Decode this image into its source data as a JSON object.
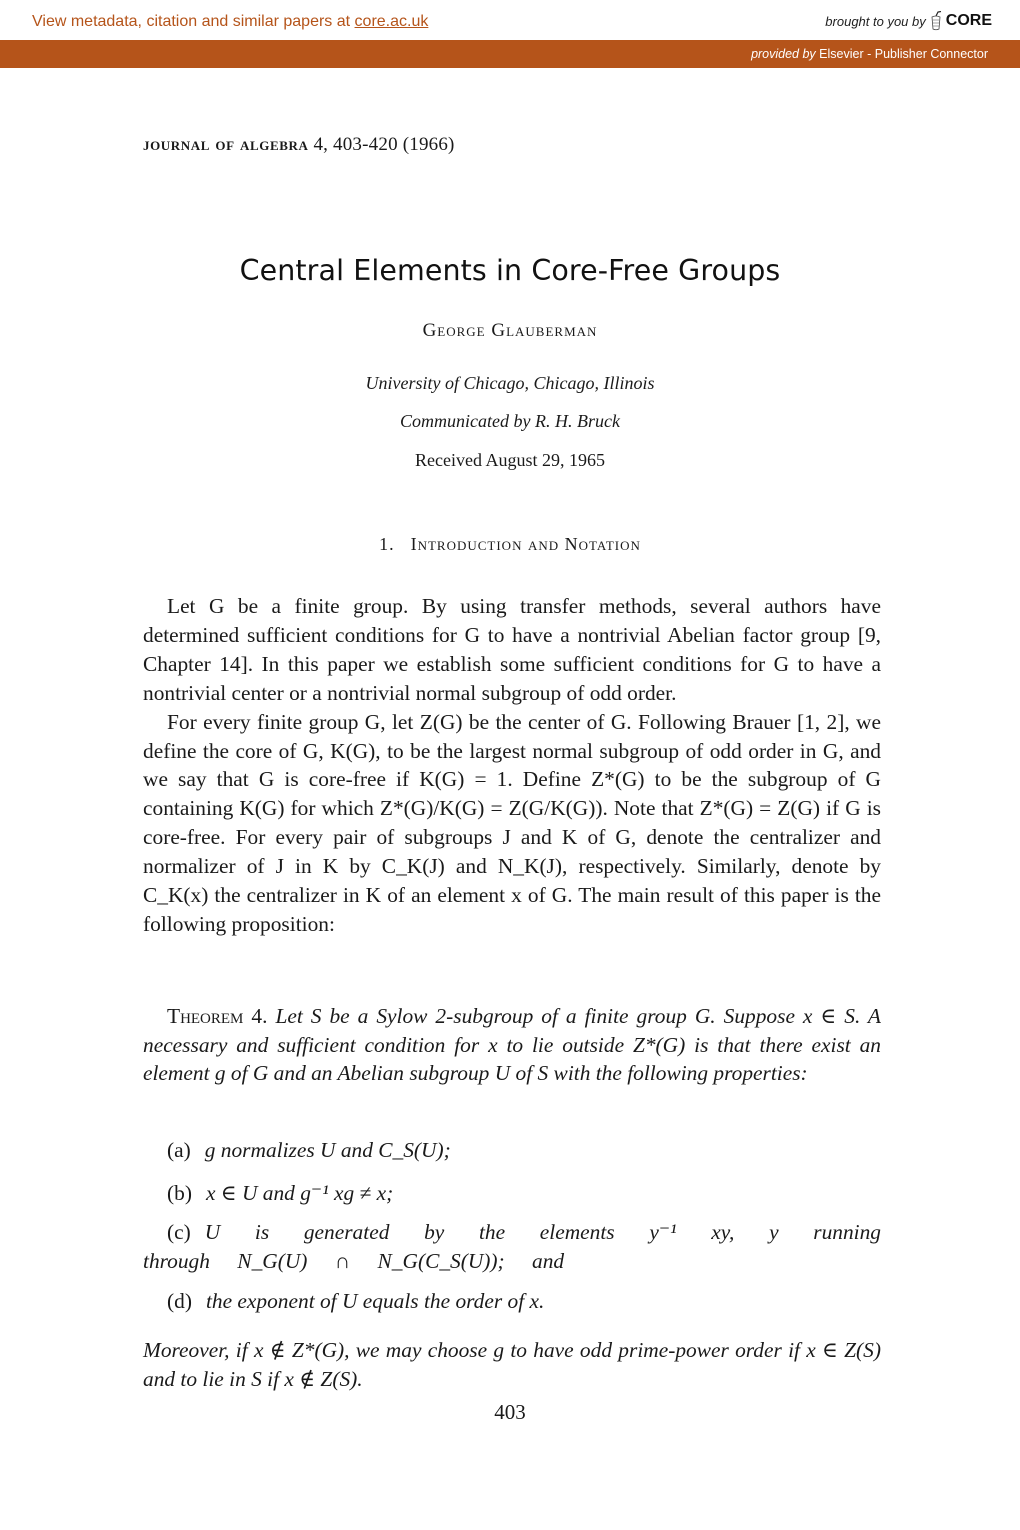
{
  "core_banner": {
    "metadata_prefix": "View metadata, citation and similar papers at ",
    "metadata_link": "core.ac.uk",
    "brought_to_you_by": "brought to you by",
    "brand": "CORE",
    "provided_by_label": "provided by",
    "provider": "Elsevier - Publisher Connector",
    "brand_color": "#b5541a",
    "icon": "core-apple-logo-icon"
  },
  "paper": {
    "journal_name": "Journal of Algebra",
    "journal_details": "4, 403-420 (1966)",
    "title": "Central Elements in Core-Free Groups",
    "author": "George Glauberman",
    "affiliation": "University of Chicago, Chicago, Illinois",
    "communicated": "Communicated by R. H. Bruck",
    "received": "Received August 29, 1965",
    "section": {
      "number": "1.",
      "title": "Introduction and Notation"
    },
    "paragraphs": [
      "Let G be a finite group. By using transfer methods, several authors have determined sufficient conditions for G to have a nontrivial Abelian factor group [9, Chapter 14]. In this paper we establish some sufficient conditions for G to have a nontrivial center or a nontrivial normal subgroup of odd order.",
      "For every finite group G, let Z(G) be the center of G. Following Brauer [1, 2], we define the core of G, K(G), to be the largest normal subgroup of odd order in G, and we say that G is core-free if K(G) = 1. Define Z*(G) to be the subgroup of G containing K(G) for which Z*(G)/K(G) = Z(G/K(G)). Note that Z*(G) = Z(G) if G is core-free. For every pair of subgroups J and K of G, denote the centralizer and normalizer of J in K by C_K(J) and N_K(J), respectively. Similarly, denote by C_K(x) the centralizer in K of an element x of G. The main result of this paper is the following proposition:"
    ],
    "theorem": {
      "label": "Theorem 4.",
      "statement": "Let S be a Sylow 2-subgroup of a finite group G. Suppose x ∈ S. A necessary and sufficient condition for x to lie outside Z*(G) is that there exist an element g of G and an Abelian subgroup U of S with the following properties:",
      "items": [
        {
          "label": "(a)",
          "text": "g normalizes U and C_S(U);"
        },
        {
          "label": "(b)",
          "text": "x ∈ U and g⁻¹ xg ≠ x;"
        },
        {
          "label": "(c)",
          "text": "U is generated by the elements y⁻¹ xy, y running through N_G(U) ∩ N_G(C_S(U)); and"
        },
        {
          "label": "(d)",
          "text": "the exponent of U equals the order of x."
        }
      ],
      "moreover": "Moreover, if x ∉ Z*(G), we may choose g to have odd prime-power order if x ∈ Z(S) and to lie in S if x ∉ Z(S)."
    },
    "page_number": "403"
  }
}
